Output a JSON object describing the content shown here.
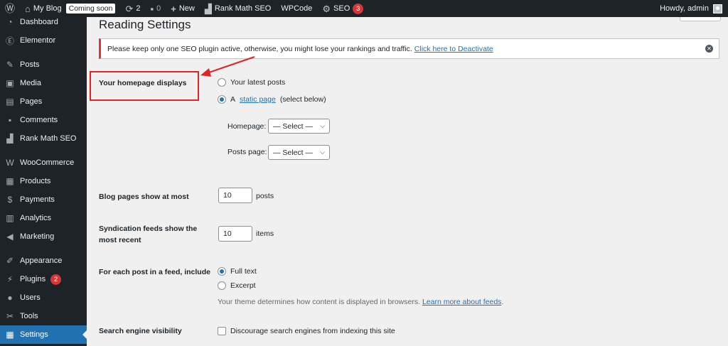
{
  "adminbar": {
    "site_name": "My Blog",
    "coming_soon": "Coming soon",
    "updates_count": "2",
    "comments_count": "0",
    "new_label": "New",
    "rank_math": "Rank Math SEO",
    "wpcode": "WPCode",
    "seo": "SEO",
    "seo_count": "3",
    "howdy": "Howdy, admin"
  },
  "sidebar": {
    "items": [
      {
        "label": "Dashboard",
        "icon": "dashboard-icon"
      },
      {
        "label": "Elementor",
        "icon": "elementor-icon"
      },
      {
        "label": "Posts",
        "icon": "pin-icon"
      },
      {
        "label": "Media",
        "icon": "media-icon"
      },
      {
        "label": "Pages",
        "icon": "pages-icon"
      },
      {
        "label": "Comments",
        "icon": "comment-icon"
      },
      {
        "label": "Rank Math SEO",
        "icon": "chart-icon"
      },
      {
        "label": "WooCommerce",
        "icon": "woocommerce-icon"
      },
      {
        "label": "Products",
        "icon": "products-icon"
      },
      {
        "label": "Payments",
        "icon": "payments-icon"
      },
      {
        "label": "Analytics",
        "icon": "analytics-icon"
      },
      {
        "label": "Marketing",
        "icon": "megaphone-icon"
      },
      {
        "label": "Appearance",
        "icon": "brush-icon"
      },
      {
        "label": "Plugins",
        "icon": "plug-icon",
        "badge": "2"
      },
      {
        "label": "Users",
        "icon": "user-icon"
      },
      {
        "label": "Tools",
        "icon": "wrench-icon"
      },
      {
        "label": "Settings",
        "icon": "settings-icon",
        "current": true
      }
    ]
  },
  "page": {
    "title": "Reading Settings"
  },
  "notice": {
    "text": "Please keep only one SEO plugin active, otherwise, you might lose your rankings and traffic.",
    "link": "Click here to Deactivate"
  },
  "homepage": {
    "label": "Your homepage displays",
    "option_latest": "Your latest posts",
    "option_static_prefix": "A",
    "option_static_link": "static page",
    "option_static_suffix": "(select below)",
    "homepage_label": "Homepage:",
    "homepage_value": "— Select —",
    "posts_page_label": "Posts page:",
    "posts_page_value": "— Select —"
  },
  "blog_pages": {
    "label": "Blog pages show at most",
    "value": "10",
    "suffix": "posts"
  },
  "syndication": {
    "label_line1": "Syndication feeds show the",
    "label_line2": "most recent",
    "value": "10",
    "suffix": "items"
  },
  "feed": {
    "label": "For each post in a feed, include",
    "option_full": "Full text",
    "option_excerpt": "Excerpt",
    "desc": "Your theme determines how content is displayed in browsers.",
    "desc_link": "Learn more about feeds"
  },
  "search": {
    "label": "Search engine visibility",
    "checkbox_label": "Discourage search engines from indexing this site"
  },
  "colors": {
    "admin_bar": "#1d2327",
    "accent": "#2271b1",
    "annotation": "#e02424"
  }
}
